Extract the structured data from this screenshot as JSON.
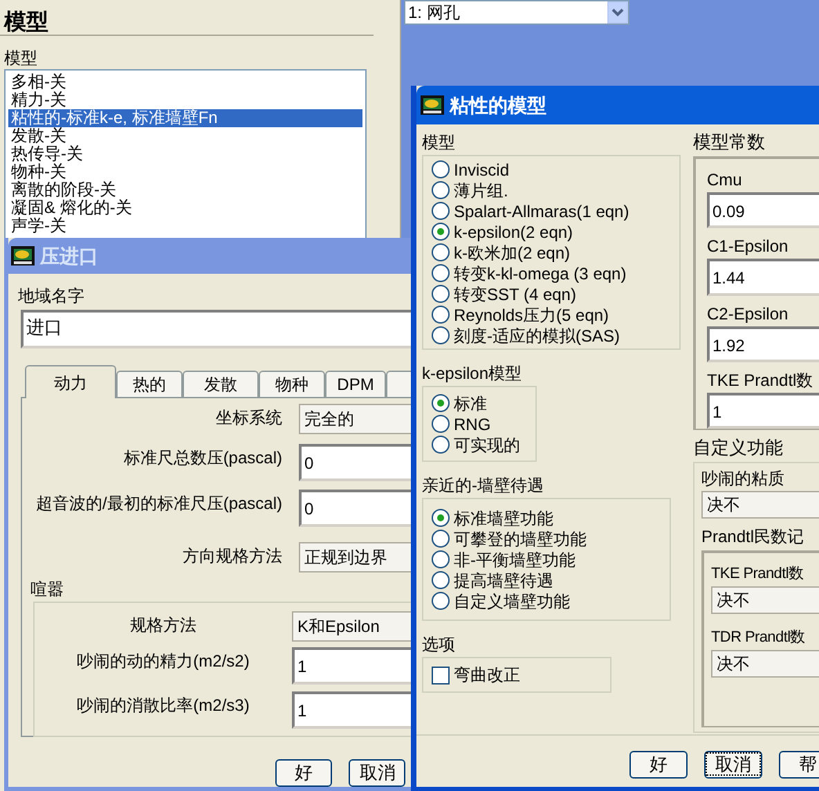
{
  "models_panel": {
    "heading": "模型",
    "list_label": "模型",
    "models": [
      {
        "label": "多相-关",
        "selected": false
      },
      {
        "label": "精力-关",
        "selected": false
      },
      {
        "label": "粘性的-标准k-e, 标准墙壁Fn",
        "selected": true
      },
      {
        "label": "发散-关",
        "selected": false
      },
      {
        "label": "热传导-关",
        "selected": false
      },
      {
        "label": "物种-关",
        "selected": false
      },
      {
        "label": "离散的阶段-关",
        "selected": false
      },
      {
        "label": "凝固& 熔化的-关",
        "selected": false
      },
      {
        "label": "声学-关",
        "selected": false
      }
    ]
  },
  "mesh_dropdown": {
    "value": "1: 网孔"
  },
  "pressure_inlet": {
    "title": "压进口",
    "zone_name_label": "地域名字",
    "zone_name": "进口",
    "tabs": [
      {
        "label": "动力",
        "selected": true
      },
      {
        "label": "热的",
        "selected": false
      },
      {
        "label": "发散",
        "selected": false
      },
      {
        "label": "物种",
        "selected": false
      },
      {
        "label": "DPM",
        "selected": false
      }
    ],
    "rows": [
      {
        "kind": "dropdown",
        "label": "坐标系统",
        "value": "完全的"
      },
      {
        "kind": "field",
        "label": "标准尺总数压(pascal)",
        "value": "0"
      },
      {
        "kind": "field",
        "label": "超音波的/最初的标准尺压(pascal)",
        "value": "0"
      },
      {
        "kind": "dropdown",
        "label": "方向规格方法",
        "value": "正规到边界"
      }
    ],
    "turbulence_label": "喧嚣",
    "turbulence_rows": [
      {
        "kind": "dropdown",
        "label": "规格方法",
        "value": "K和Epsilon"
      },
      {
        "kind": "field",
        "label": "吵闹的动的精力(m2/s2)",
        "value": "1"
      },
      {
        "kind": "field",
        "label": "吵闹的消散比率(m2/s3)",
        "value": "1"
      }
    ],
    "buttons": [
      "好",
      "取消"
    ]
  },
  "viscous_model": {
    "title": "粘性的模型",
    "model_label": "模型",
    "models": [
      {
        "label": "Inviscid",
        "selected": false
      },
      {
        "label": "薄片组.",
        "selected": false
      },
      {
        "label": "Spalart-Allmaras(1 eqn)",
        "selected": false
      },
      {
        "label": "k-epsilon(2 eqn)",
        "selected": true
      },
      {
        "label": "k-欧米加(2 eqn)",
        "selected": false
      },
      {
        "label": "转变k-kl-omega (3 eqn)",
        "selected": false
      },
      {
        "label": "转变SST (4 eqn)",
        "selected": false
      },
      {
        "label": "Reynolds压力(5 eqn)",
        "selected": false
      },
      {
        "label": "刻度-适应的模拟(SAS)",
        "selected": false
      }
    ],
    "k_epsilon_label": "k-epsilon模型",
    "k_epsilon_models": [
      {
        "label": "标准",
        "selected": true
      },
      {
        "label": "RNG",
        "selected": false
      },
      {
        "label": "可实现的",
        "selected": false
      }
    ],
    "near_wall_label": "亲近的-墙壁待遇",
    "near_wall": [
      {
        "label": "标准墙壁功能",
        "selected": true
      },
      {
        "label": "可攀登的墙壁功能",
        "selected": false
      },
      {
        "label": "非-平衡墙壁功能",
        "selected": false
      },
      {
        "label": "提高墙壁待遇",
        "selected": false
      },
      {
        "label": "自定义墙壁功能",
        "selected": false
      }
    ],
    "options_label": "选项",
    "options": [
      {
        "label": "弯曲改正",
        "checked": false
      }
    ],
    "constants_label": "模型常数",
    "constants": [
      {
        "label": "Cmu",
        "value": "0.09"
      },
      {
        "label": "C1-Epsilon",
        "value": "1.44"
      },
      {
        "label": "C2-Epsilon",
        "value": "1.92"
      },
      {
        "label": "TKE Prandtl数",
        "value": "1"
      }
    ],
    "udf_label": "自定义功能",
    "turbulent_viscosity_label": "吵闹的粘质",
    "turbulent_viscosity": "决不",
    "prandtl_label": "Prandtl民数记",
    "prandtl": [
      {
        "label": "TKE Prandtl数",
        "value": "决不"
      },
      {
        "label": "TDR Prandtl数",
        "value": "决不"
      }
    ],
    "buttons": [
      {
        "label": "好",
        "focused": false
      },
      {
        "label": "取消",
        "focused": true
      },
      {
        "label": "帮",
        "focused": false
      }
    ]
  }
}
